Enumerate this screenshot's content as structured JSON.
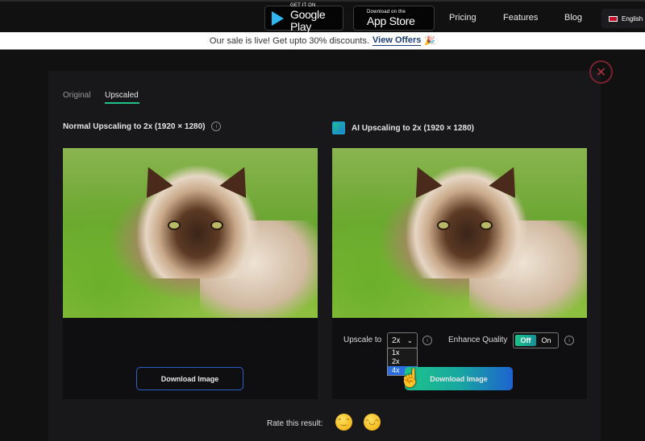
{
  "header": {
    "google_play": {
      "small": "GET IT ON",
      "big": "Google Play"
    },
    "app_store": {
      "small": "Download on the",
      "big": "App Store"
    },
    "nav": [
      "Pricing",
      "Features",
      "Blog"
    ],
    "language": "English"
  },
  "banner": {
    "text": "Our sale is live! Get upto 30% discounts.",
    "link": "View Offers",
    "emoji": "🎉"
  },
  "tabs": [
    {
      "label": "Original",
      "active": false
    },
    {
      "label": "Upscaled",
      "active": true
    }
  ],
  "left": {
    "heading": "Normal Upscaling to 2x (1920 × 1280)",
    "download_label": "Download Image"
  },
  "right": {
    "heading": "AI Upscaling to 2x (1920 × 1280)",
    "upscale_label": "Upscale to",
    "upscale_value": "2x",
    "upscale_options": [
      "1x",
      "2x",
      "4x"
    ],
    "highlighted_option": "4x",
    "enhance_label": "Enhance Quality",
    "toggle_off": "Off",
    "toggle_on": "On",
    "enhance_state": "Off",
    "download_label": "Download Image"
  },
  "rating": {
    "label": "Rate this result:",
    "emojis": [
      "😔",
      "😀"
    ]
  },
  "colors": {
    "accent_green": "#1cc38a",
    "accent_blue": "#1e63d0",
    "close_red": "#b03040"
  }
}
